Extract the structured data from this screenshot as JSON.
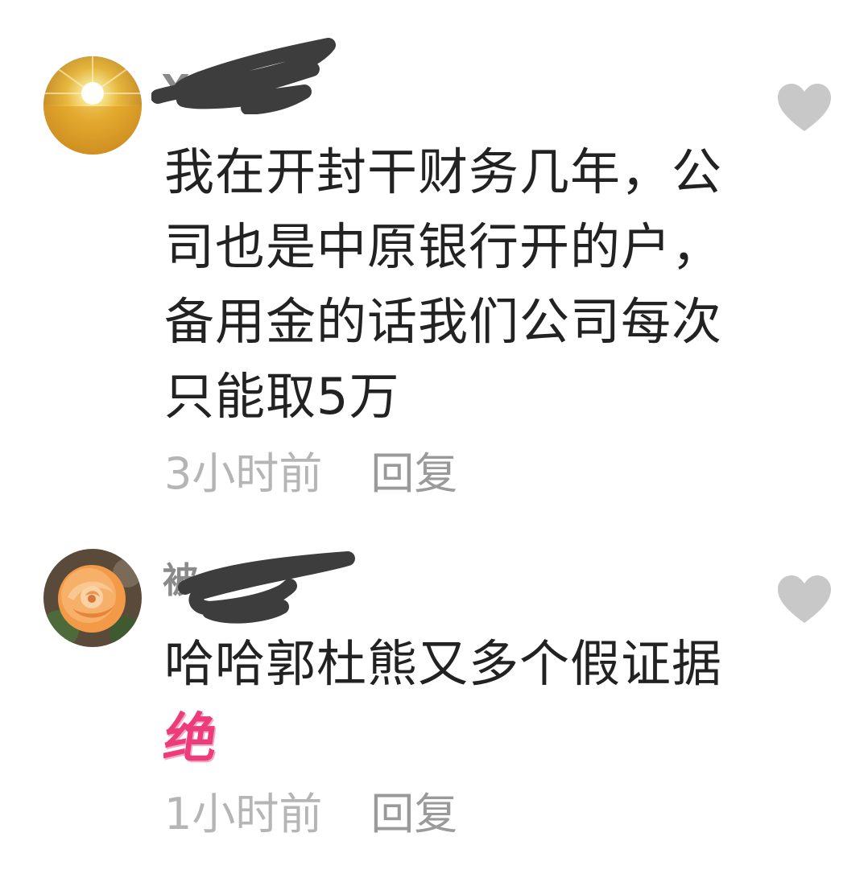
{
  "comments": [
    {
      "username": "Y",
      "avatar": "sunrise-wheat-field",
      "text": "我在开封干财务几年，公司也是中原银行开的户，备用金的话我们公司每次只能取5万",
      "time": "3小时前",
      "reply_label": "回复",
      "like_icon": "heart-icon"
    },
    {
      "username": "被",
      "avatar": "orange-rose",
      "text": "哈哈郭杜熊又多个假证据",
      "sticker": "绝",
      "time": "1小时前",
      "reply_label": "回复",
      "like_icon": "heart-icon"
    }
  ],
  "colors": {
    "text": "#222222",
    "time": "#b5b5b5",
    "reply": "#9a9a9a",
    "heart": "#c8c8c8",
    "sticker": "#ec3d7a",
    "redaction": "#3d3d3d"
  }
}
